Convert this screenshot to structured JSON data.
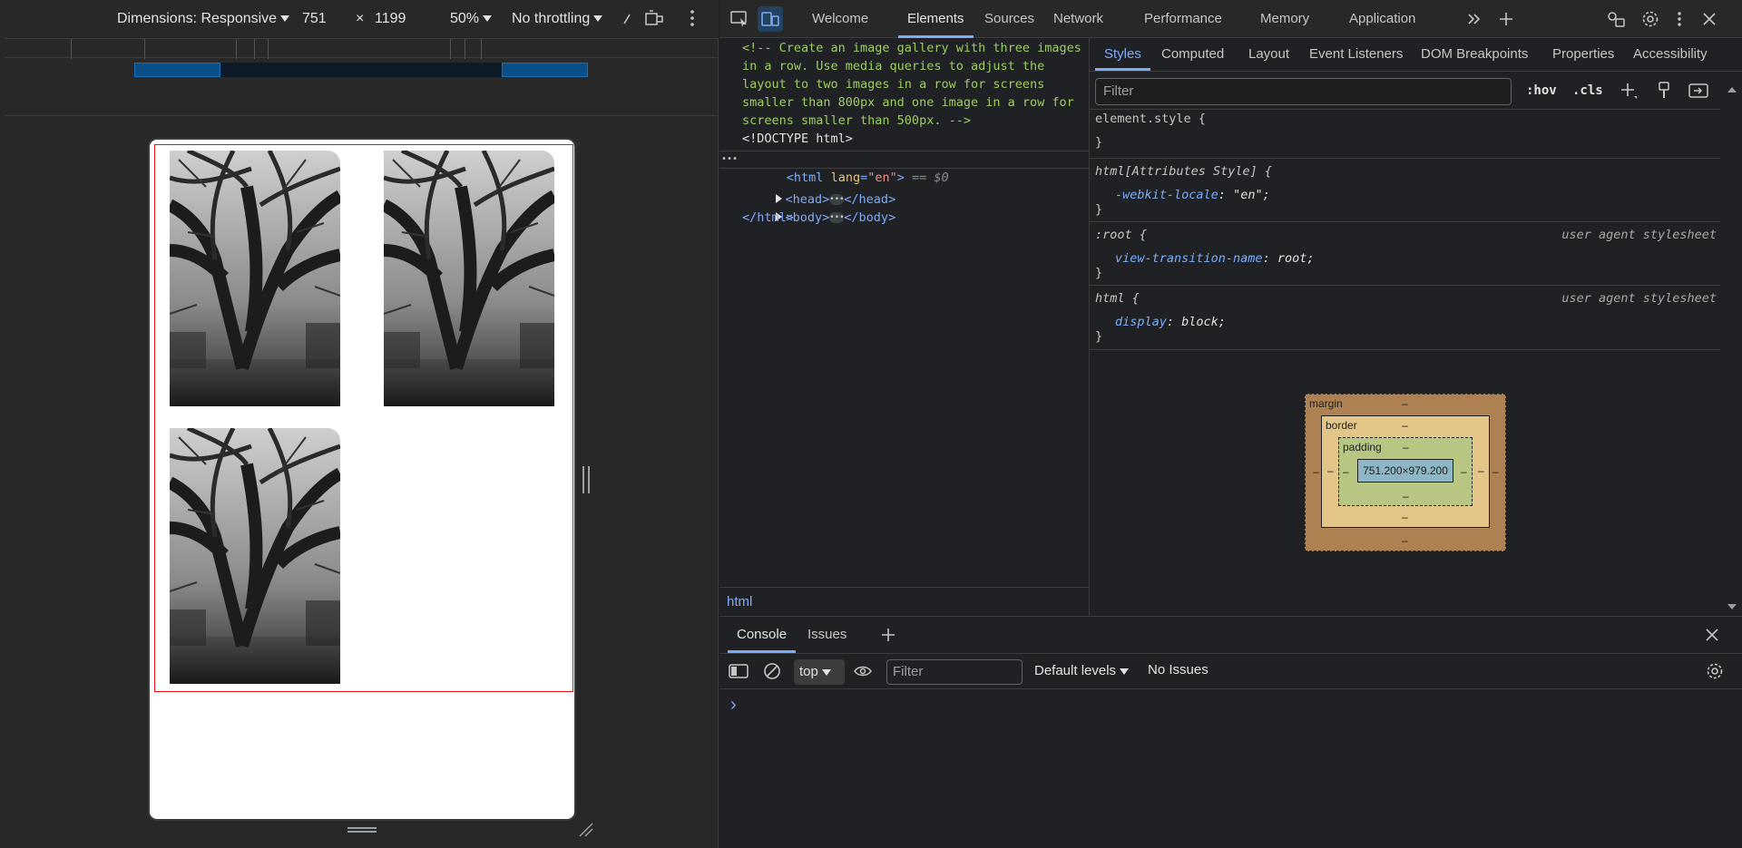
{
  "device_toolbar": {
    "dimensions_label": "Dimensions: Responsive",
    "width": "751",
    "times": "×",
    "height": "1199",
    "zoom": "50%",
    "throttling": "No throttling"
  },
  "devtools_tabs": [
    {
      "label": "Welcome"
    },
    {
      "label": "Elements"
    },
    {
      "label": "Sources"
    },
    {
      "label": "Network"
    },
    {
      "label": "Performance"
    },
    {
      "label": "Memory"
    },
    {
      "label": "Application"
    }
  ],
  "dom": {
    "comment": [
      "<!-- Create an image gallery with three images",
      "in a row. Use media queries to adjust the",
      "layout to two images in a row for screens",
      "smaller than 800px and one image in a row for",
      "screens smaller than 500px. -->"
    ],
    "doctype": "<!DOCTYPE html>",
    "html_open_tag": "<html",
    "html_attr_name": "lang",
    "html_attr_value": "\"en\"",
    "html_close_bracket": ">",
    "selected_marker": "== $0",
    "head_open": "<head>",
    "head_close": "</head>",
    "body_open": "<body>",
    "body_close": "</body>",
    "html_close": "</html>",
    "row_dots": "•••",
    "breadcrumb": "html"
  },
  "styles_tabs": [
    {
      "label": "Styles"
    },
    {
      "label": "Computed"
    },
    {
      "label": "Layout"
    },
    {
      "label": "Event Listeners"
    },
    {
      "label": "DOM Breakpoints"
    },
    {
      "label": "Properties"
    },
    {
      "label": "Accessibility"
    }
  ],
  "styles": {
    "filter_placeholder": "Filter",
    "hov": ":hov",
    "cls": ".cls",
    "open_brace": "{",
    "close_brace": "}",
    "rules": [
      {
        "selector": "element.style {",
        "source": "",
        "prop": "",
        "value": ""
      },
      {
        "selector": "html[Attributes Style] {",
        "source": "",
        "prop": "-webkit-locale",
        "value": "\"en\";"
      },
      {
        "selector": ":root {",
        "source": "user agent stylesheet",
        "prop": "view-transition-name",
        "value": "root;"
      },
      {
        "selector": "html {",
        "source": "user agent stylesheet",
        "prop": "display",
        "value": "block;"
      }
    ],
    "box_model": {
      "margin_label": "margin",
      "border_label": "border",
      "padding_label": "padding",
      "content_size": "751.200×979.200",
      "dash": "–"
    }
  },
  "console": {
    "tabs": [
      {
        "label": "Console"
      },
      {
        "label": "Issues"
      }
    ],
    "context": "top",
    "filter_placeholder": "Filter",
    "levels": "Default levels",
    "issues": "No Issues",
    "prompt": "›"
  },
  "colors": {
    "accent": "#7cacf8",
    "highlight_border": "#e4151a",
    "margin": "#ae8152",
    "border": "#e2c587",
    "padding": "#b8c683",
    "content": "#8db6c6"
  }
}
